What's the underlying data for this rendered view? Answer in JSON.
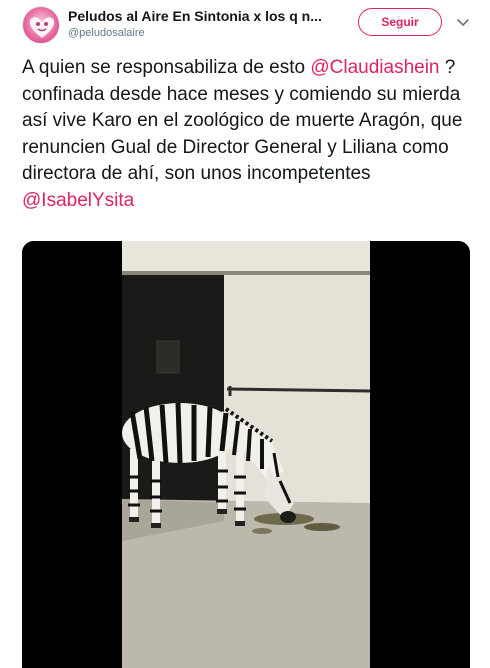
{
  "account": {
    "display_name": "Peludos al Aire En Sintonia x los q n...",
    "handle": "@peludosalaire",
    "avatar_icon": "heart-dog-logo-icon"
  },
  "follow_button": {
    "label": "Seguir"
  },
  "menu": {
    "icon": "chevron-down-icon"
  },
  "tweet": {
    "part1": "A quien se responsabiliza de esto ",
    "mention1": "@Claudiashein",
    "part2": " ? confinada desde hace meses y comiendo su mierda así vive Karo en el zoológico de muerte Aragón, que renuncien Gual  de Director General y Liliana como directora de ahí, son unos incompetentes ",
    "mention2": "@IsabelYsita"
  },
  "colors": {
    "accent": "#e0245e",
    "text": "#14171a",
    "secondary": "#657786"
  }
}
